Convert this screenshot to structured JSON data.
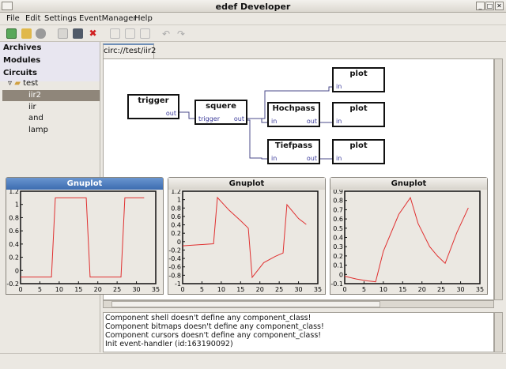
{
  "window": {
    "title": "edef Developer"
  },
  "menu": [
    "File",
    "Edit",
    "Settings",
    "EventManager",
    "Help"
  ],
  "toolbar_icons": [
    "new-icon",
    "open-icon",
    "delete-icon",
    "save-icon",
    "save-as-icon",
    "close-icon",
    "copy-icon",
    "cut-icon",
    "paste-icon",
    "undo-icon",
    "redo-icon"
  ],
  "sidebar": {
    "archives": "Archives",
    "modules": "Modules",
    "circuits": "Circuits",
    "tree": {
      "folder": "test",
      "items": [
        "iir2",
        "iir",
        "and",
        "lamp"
      ],
      "selected": "iir2"
    }
  },
  "tab": {
    "label": "circ://test/iir2"
  },
  "blocks": {
    "trigger": "trigger",
    "squere": "squere",
    "hochpass": "Hochpass",
    "tiefpass": "Tiefpass",
    "plot": "plot",
    "out": "out",
    "in": "in",
    "trigger_in": "trigger"
  },
  "log": [
    "Component shell doesn't define any component_class!",
    "Component bitmaps doesn't define any component_class!",
    "Component cursors doesn't define any component_class!",
    "Init event-handler (id:163190092)"
  ],
  "colors": {
    "line": "#e03030",
    "accent": "#3c6cb0"
  },
  "chart_data": [
    {
      "type": "line",
      "title": "Gnuplot",
      "xlim": [
        0,
        35
      ],
      "ylim": [
        -0.2,
        1.2
      ],
      "xticks": [
        0,
        5,
        10,
        15,
        20,
        25,
        30,
        35
      ],
      "yticks": [
        -0.2,
        0,
        0.2,
        0.4,
        0.6,
        0.8,
        1,
        1.2
      ],
      "x": [
        0,
        8,
        9,
        17,
        18,
        26,
        27,
        32
      ],
      "y": [
        -0.1,
        -0.1,
        1.1,
        1.1,
        -0.1,
        -0.1,
        1.1,
        1.1
      ]
    },
    {
      "type": "line",
      "title": "Gnuplot",
      "xlim": [
        0,
        35
      ],
      "ylim": [
        -1,
        1.2
      ],
      "xticks": [
        0,
        5,
        10,
        15,
        20,
        25,
        30,
        35
      ],
      "yticks": [
        -1,
        -0.8,
        -0.6,
        -0.4,
        -0.2,
        0,
        0.2,
        0.4,
        0.6,
        0.8,
        1,
        1.2
      ],
      "x": [
        0,
        8,
        9,
        12,
        15,
        17,
        18,
        21,
        24,
        26,
        27,
        30,
        32
      ],
      "y": [
        -0.1,
        -0.05,
        1.05,
        0.75,
        0.5,
        0.32,
        -0.85,
        -0.5,
        -0.35,
        -0.27,
        0.88,
        0.55,
        0.41
      ]
    },
    {
      "type": "line",
      "title": "Gnuplot",
      "xlim": [
        0,
        35
      ],
      "ylim": [
        -0.1,
        0.9
      ],
      "xticks": [
        0,
        5,
        10,
        15,
        20,
        25,
        30,
        35
      ],
      "yticks": [
        -0.1,
        0,
        0.1,
        0.2,
        0.3,
        0.4,
        0.5,
        0.6,
        0.7,
        0.8,
        0.9
      ],
      "x": [
        0,
        3,
        6,
        8,
        10,
        14,
        17,
        19,
        22,
        24,
        26,
        29,
        32
      ],
      "y": [
        -0.02,
        -0.05,
        -0.07,
        -0.08,
        0.25,
        0.65,
        0.83,
        0.55,
        0.3,
        0.2,
        0.12,
        0.45,
        0.72
      ]
    }
  ]
}
